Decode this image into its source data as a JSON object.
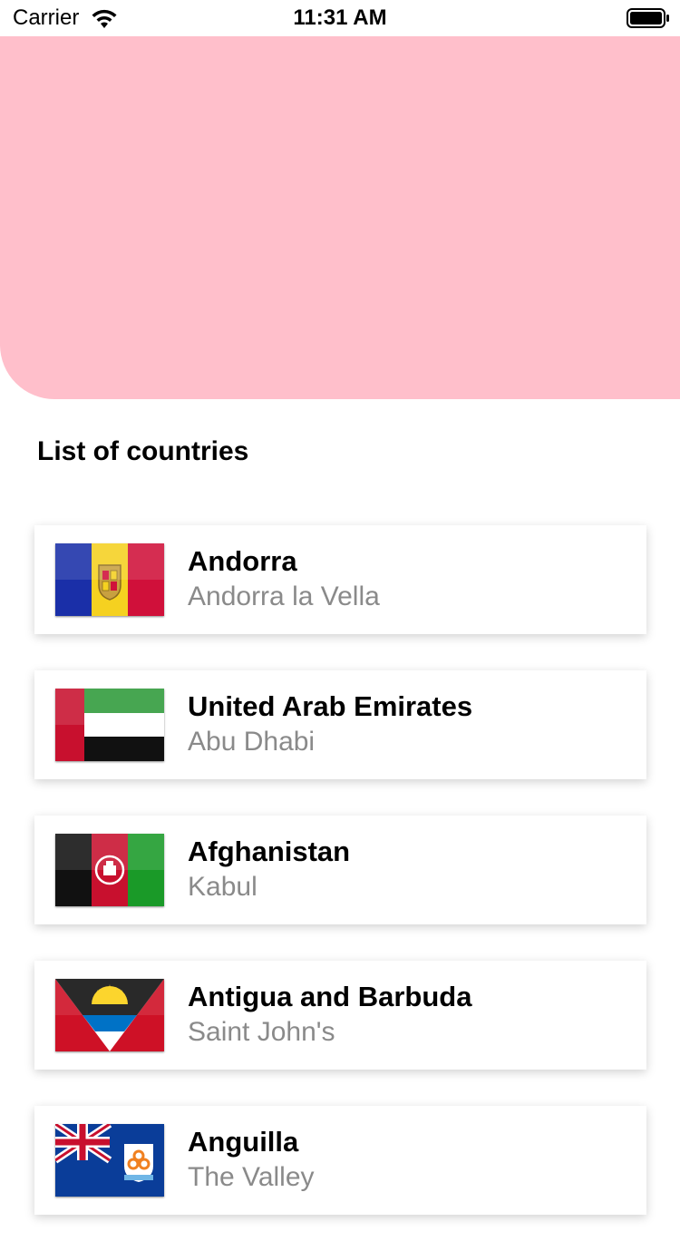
{
  "status_bar": {
    "carrier": "Carrier",
    "time": "11:31 AM",
    "wifi_icon": "wifi-icon",
    "battery_icon": "battery-icon"
  },
  "header": {
    "background_color": "#ffbfcb"
  },
  "title": "List of countries",
  "countries": [
    {
      "name": "Andorra",
      "capital": "Andorra la Vella",
      "flag_icon": "andorra-flag-icon"
    },
    {
      "name": "United Arab Emirates",
      "capital": "Abu Dhabi",
      "flag_icon": "uae-flag-icon"
    },
    {
      "name": "Afghanistan",
      "capital": "Kabul",
      "flag_icon": "afghanistan-flag-icon"
    },
    {
      "name": "Antigua and Barbuda",
      "capital": "Saint John's",
      "flag_icon": "antigua-barbuda-flag-icon"
    },
    {
      "name": "Anguilla",
      "capital": "The Valley",
      "flag_icon": "anguilla-flag-icon"
    }
  ]
}
